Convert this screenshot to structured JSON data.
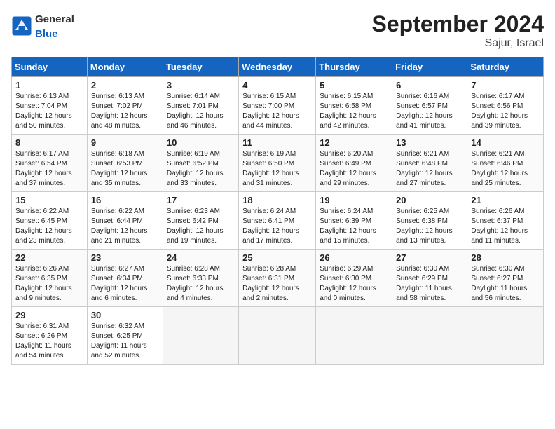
{
  "header": {
    "logo_general": "General",
    "logo_blue": "Blue",
    "month_title": "September 2024",
    "location": "Sajur, Israel"
  },
  "weekdays": [
    "Sunday",
    "Monday",
    "Tuesday",
    "Wednesday",
    "Thursday",
    "Friday",
    "Saturday"
  ],
  "weeks": [
    [
      {
        "day": "1",
        "info": "Sunrise: 6:13 AM\nSunset: 7:04 PM\nDaylight: 12 hours\nand 50 minutes."
      },
      {
        "day": "2",
        "info": "Sunrise: 6:13 AM\nSunset: 7:02 PM\nDaylight: 12 hours\nand 48 minutes."
      },
      {
        "day": "3",
        "info": "Sunrise: 6:14 AM\nSunset: 7:01 PM\nDaylight: 12 hours\nand 46 minutes."
      },
      {
        "day": "4",
        "info": "Sunrise: 6:15 AM\nSunset: 7:00 PM\nDaylight: 12 hours\nand 44 minutes."
      },
      {
        "day": "5",
        "info": "Sunrise: 6:15 AM\nSunset: 6:58 PM\nDaylight: 12 hours\nand 42 minutes."
      },
      {
        "day": "6",
        "info": "Sunrise: 6:16 AM\nSunset: 6:57 PM\nDaylight: 12 hours\nand 41 minutes."
      },
      {
        "day": "7",
        "info": "Sunrise: 6:17 AM\nSunset: 6:56 PM\nDaylight: 12 hours\nand 39 minutes."
      }
    ],
    [
      {
        "day": "8",
        "info": "Sunrise: 6:17 AM\nSunset: 6:54 PM\nDaylight: 12 hours\nand 37 minutes."
      },
      {
        "day": "9",
        "info": "Sunrise: 6:18 AM\nSunset: 6:53 PM\nDaylight: 12 hours\nand 35 minutes."
      },
      {
        "day": "10",
        "info": "Sunrise: 6:19 AM\nSunset: 6:52 PM\nDaylight: 12 hours\nand 33 minutes."
      },
      {
        "day": "11",
        "info": "Sunrise: 6:19 AM\nSunset: 6:50 PM\nDaylight: 12 hours\nand 31 minutes."
      },
      {
        "day": "12",
        "info": "Sunrise: 6:20 AM\nSunset: 6:49 PM\nDaylight: 12 hours\nand 29 minutes."
      },
      {
        "day": "13",
        "info": "Sunrise: 6:21 AM\nSunset: 6:48 PM\nDaylight: 12 hours\nand 27 minutes."
      },
      {
        "day": "14",
        "info": "Sunrise: 6:21 AM\nSunset: 6:46 PM\nDaylight: 12 hours\nand 25 minutes."
      }
    ],
    [
      {
        "day": "15",
        "info": "Sunrise: 6:22 AM\nSunset: 6:45 PM\nDaylight: 12 hours\nand 23 minutes."
      },
      {
        "day": "16",
        "info": "Sunrise: 6:22 AM\nSunset: 6:44 PM\nDaylight: 12 hours\nand 21 minutes."
      },
      {
        "day": "17",
        "info": "Sunrise: 6:23 AM\nSunset: 6:42 PM\nDaylight: 12 hours\nand 19 minutes."
      },
      {
        "day": "18",
        "info": "Sunrise: 6:24 AM\nSunset: 6:41 PM\nDaylight: 12 hours\nand 17 minutes."
      },
      {
        "day": "19",
        "info": "Sunrise: 6:24 AM\nSunset: 6:39 PM\nDaylight: 12 hours\nand 15 minutes."
      },
      {
        "day": "20",
        "info": "Sunrise: 6:25 AM\nSunset: 6:38 PM\nDaylight: 12 hours\nand 13 minutes."
      },
      {
        "day": "21",
        "info": "Sunrise: 6:26 AM\nSunset: 6:37 PM\nDaylight: 12 hours\nand 11 minutes."
      }
    ],
    [
      {
        "day": "22",
        "info": "Sunrise: 6:26 AM\nSunset: 6:35 PM\nDaylight: 12 hours\nand 9 minutes."
      },
      {
        "day": "23",
        "info": "Sunrise: 6:27 AM\nSunset: 6:34 PM\nDaylight: 12 hours\nand 6 minutes."
      },
      {
        "day": "24",
        "info": "Sunrise: 6:28 AM\nSunset: 6:33 PM\nDaylight: 12 hours\nand 4 minutes."
      },
      {
        "day": "25",
        "info": "Sunrise: 6:28 AM\nSunset: 6:31 PM\nDaylight: 12 hours\nand 2 minutes."
      },
      {
        "day": "26",
        "info": "Sunrise: 6:29 AM\nSunset: 6:30 PM\nDaylight: 12 hours\nand 0 minutes."
      },
      {
        "day": "27",
        "info": "Sunrise: 6:30 AM\nSunset: 6:29 PM\nDaylight: 11 hours\nand 58 minutes."
      },
      {
        "day": "28",
        "info": "Sunrise: 6:30 AM\nSunset: 6:27 PM\nDaylight: 11 hours\nand 56 minutes."
      }
    ],
    [
      {
        "day": "29",
        "info": "Sunrise: 6:31 AM\nSunset: 6:26 PM\nDaylight: 11 hours\nand 54 minutes."
      },
      {
        "day": "30",
        "info": "Sunrise: 6:32 AM\nSunset: 6:25 PM\nDaylight: 11 hours\nand 52 minutes."
      },
      {
        "day": "",
        "info": ""
      },
      {
        "day": "",
        "info": ""
      },
      {
        "day": "",
        "info": ""
      },
      {
        "day": "",
        "info": ""
      },
      {
        "day": "",
        "info": ""
      }
    ]
  ]
}
